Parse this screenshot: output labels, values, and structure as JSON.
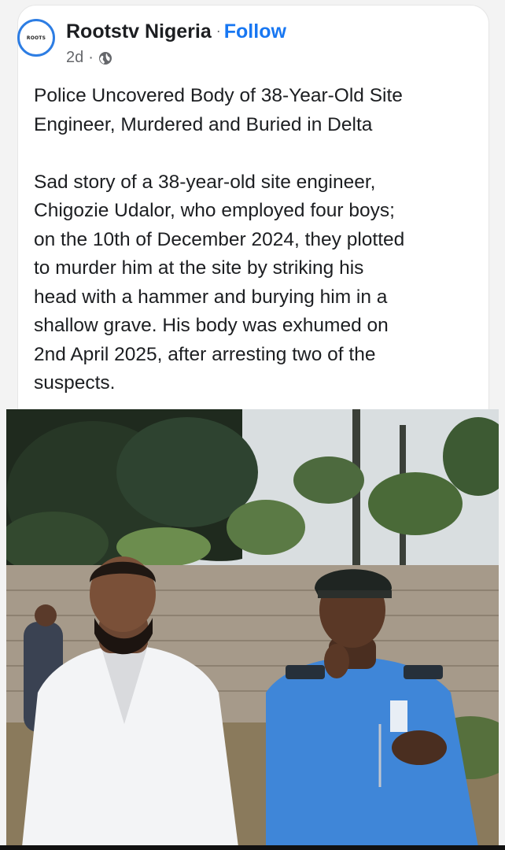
{
  "post": {
    "avatar_text": "ROOTS",
    "page_name": "Rootstv Nigeria",
    "separator": "·",
    "follow_label": "Follow",
    "time": "2d",
    "meta_separator": "·",
    "privacy_icon": "globe-icon",
    "headline_line1": "Police Uncovered Body of 38-Year-Old Site",
    "headline_line2": "Engineer, Murdered and Buried in Delta",
    "body_lines": [
      "Sad story of a 38-year-old site engineer,",
      "Chigozie Udalor, who employed four boys;",
      "on the 10th of December 2024, they plotted",
      "to murder him at the site by striking his",
      "head with a hammer and burying him in a",
      "shallow grave. His body was exhumed on",
      "2nd April 2025, after arresting two of the",
      "suspects."
    ]
  },
  "colors": {
    "accent": "#1877f2",
    "text": "#1c1e21",
    "muted": "#65676b",
    "avatar_ring": "#2d7de3"
  }
}
